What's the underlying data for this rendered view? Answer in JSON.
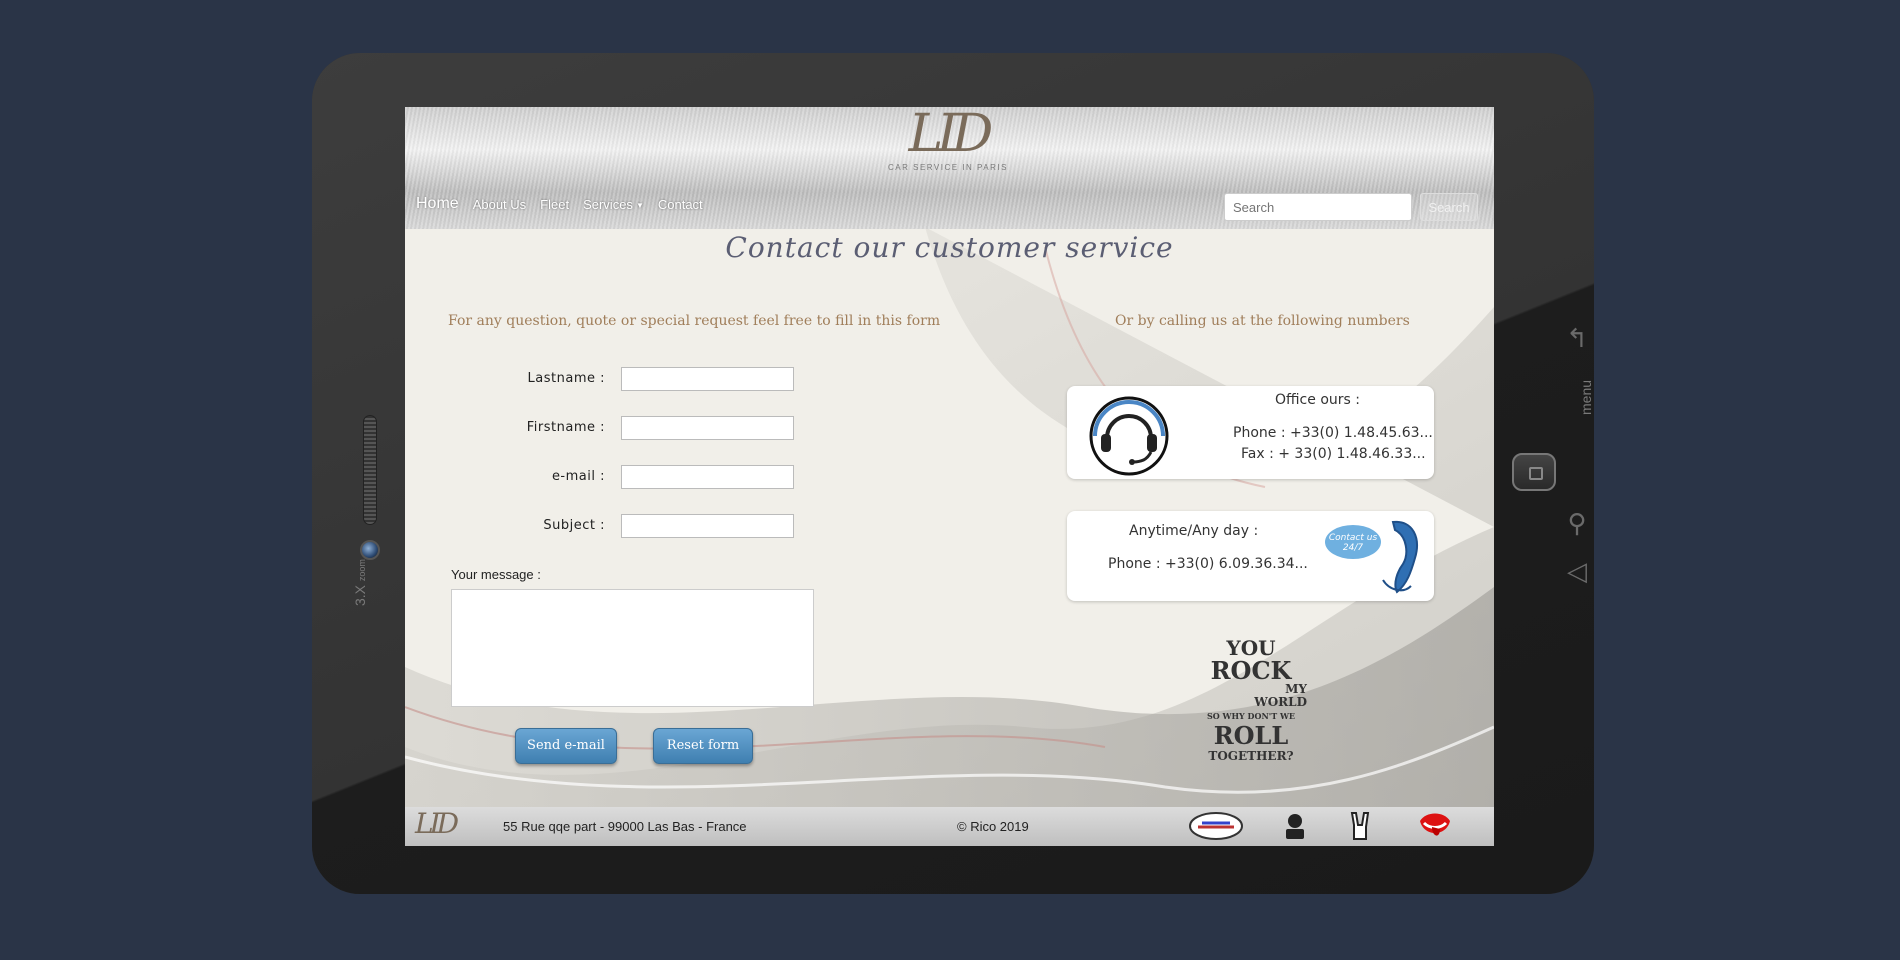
{
  "device": {
    "zoom_label": "3.X",
    "zoom_sub": "zoom",
    "menu_label": "menu"
  },
  "header": {
    "logo_text": "LID",
    "logo_subtitle": "CAR SERVICE IN PARIS"
  },
  "nav": {
    "home": "Home",
    "items": [
      "About Us",
      "Fleet",
      "Services",
      "Contact"
    ]
  },
  "search": {
    "placeholder": "Search",
    "button": "Search"
  },
  "page_title": "Contact our customer service",
  "form_intro": "For any question, quote or special request feel free to fill in this form",
  "phone_intro": "Or by calling us at the following numbers",
  "form": {
    "lastname_label": "Lastname :",
    "firstname_label": "Firstname :",
    "email_label": "e-mail :",
    "subject_label": "Subject :",
    "message_label": "Your message :",
    "send_button": "Send e-mail",
    "reset_button": "Reset  form"
  },
  "office_card": {
    "title": "Office ours :",
    "phone": "Phone : +33(0) 1.48.45.63...",
    "fax": "Fax : + 33(0) 1.48.46.33..."
  },
  "anytime_card": {
    "title": "Anytime/Any day :",
    "phone": "Phone : +33(0) 6.09.36.34...",
    "badge": "Contact us 24/7"
  },
  "rock_tee": {
    "line1": "YOU",
    "line2": "ROCK",
    "line3": "MY",
    "line4": "WORLD",
    "line5": "SO WHY DON'T WE",
    "line6": "ROLL",
    "line7": "TOGETHER?"
  },
  "footer": {
    "logo_text": "LID",
    "address": "55 Rue qqe part - 99000 Las Bas - France",
    "copyright": "© Rico 2019",
    "icons": [
      "grande-route-icon",
      "rock-icon",
      "rock-hand-icon",
      "rolling-stones-lips-icon"
    ]
  },
  "colors": {
    "background": "#2a3447",
    "title": "#5b5e73",
    "intro": "#a07e5a",
    "button": "#4a8cbf"
  }
}
